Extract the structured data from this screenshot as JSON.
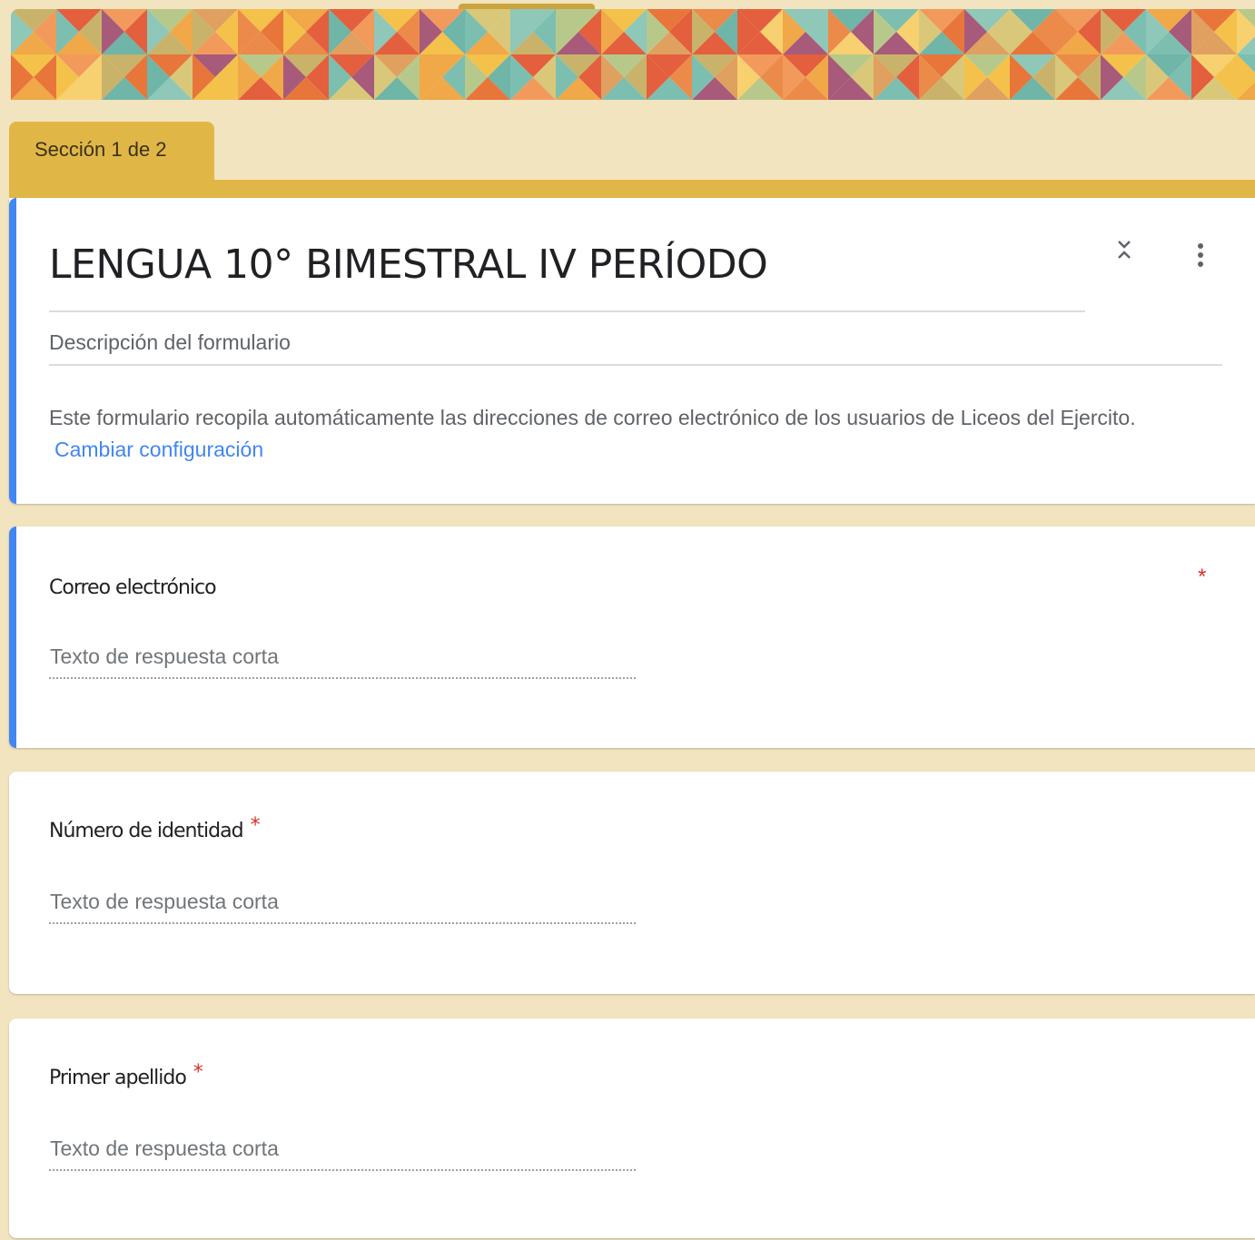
{
  "theme": {
    "background": "#f2e4be",
    "accent": "#e0b747",
    "active_bar": "#4285f4",
    "required": "#d93025",
    "link": "#4285f4"
  },
  "section": {
    "label": "Sección 1 de 2"
  },
  "header": {
    "title": "LENGUA 10° BIMESTRAL IV PERÍODO",
    "description_placeholder": "Descripción del formulario",
    "notice_text": "Este formulario recopila automáticamente las direcciones de correo electrónico de los usuarios de Liceos del Ejercito.",
    "notice_link": "Cambiar configuración",
    "collapse_icon": "collapse-icon",
    "more_icon": "more-vert-icon"
  },
  "questions": [
    {
      "title": "Correo electrónico",
      "required_mark": "*",
      "answer_placeholder": "Texto de respuesta corta"
    },
    {
      "title": "Número de identidad",
      "required_mark": "*",
      "answer_placeholder": "Texto de respuesta corta"
    },
    {
      "title": "Primer apellido",
      "required_mark": "*",
      "answer_placeholder": "Texto de respuesta corta"
    }
  ]
}
